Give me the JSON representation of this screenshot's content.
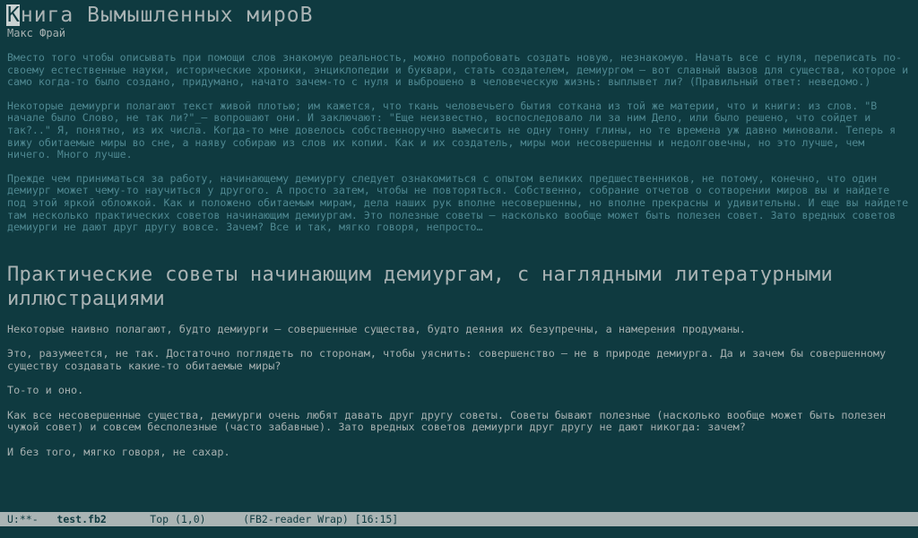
{
  "book": {
    "title_first": "К",
    "title_rest": "нига Вымышленных мироВ",
    "author": "Макс Фрай"
  },
  "annotation": [
    "Вместо того чтобы описывать при помощи слов знакомую реальность, можно попробовать создать новую, незнакомую. Начать все с нуля, переписать по-своему естественные науки, исторические хроники, энциклопедии и буквари, стать создателем, демиургом – вот славный вызов для существа, которое и само когда-то было создано, придумано, начато зачем-то с нуля и выброшено в человеческую жизнь: выплывет ли? (Правильный ответ: неведомо.)",
    "Некоторые демиурги полагают текст живой плотью; им кажется, что ткань человечьего бытия соткана из той же материи, что и книги: из слов. \"В начале было Слово, не так ли?\"_– вопрошают они. И заключают: \"Еще неизвестно, воспоследовало ли за ним Дело, или было решено, что сойдет и так?..\" Я, понятно, из их числа. Когда-то мне довелось собственноручно вымесить не одну тонну глины, но те времена уж давно миновали. Теперь я вижу обитаемые миры во сне, а наяву собираю из слов их копии. Как и их создатель, миры мои несовершенны и недолговечны, но это лучше, чем ничего. Много лучше.",
    "Прежде чем приниматься за работу, начинающему демиургу следует ознакомиться с опытом великих предшественников, не потому, конечно, что один демиург может чему-то научиться у другого. А просто затем, чтобы не повторяться. Собственно, собрание отчетов о сотворении миров вы и найдете под этой яркой обложкой. Как и положено обитаемым мирам, дела наших рук вполне несовершенны, но вполне прекрасны и удивительны. И еще вы найдете там несколько практических советов начинающим демиургам. Это полезные советы – насколько вообще может быть полезен совет. Зато вредных советов демиурги не дают друг другу вовсе. Зачем? Все и так, мягко говоря, непросто…"
  ],
  "section": {
    "title": "Практические советы начинающим демиургам, с наглядными литературными иллюстрациями",
    "paragraphs": [
      "Некоторые наивно полагают, будто демиурги – совершенные существа, будто деяния их безупречны, а намерения продуманы.",
      "Это, разумеется, не так. Достаточно поглядеть по сторонам, чтобы уяснить: совершенство – не в природе демиурга. Да и зачем бы совершенному существу создавать какие-то обитаемые миры?",
      "То-то и оно.",
      "Как все несовершенные существа, демиурги очень любят давать друг другу советы. Советы бывают полезные (насколько вообще может быть полезен чужой совет) и совсем бесполезные (часто забавные). Зато вредных советов демиурги друг другу не дают никогда: зачем?",
      "И без того, мягко говоря, не сахар."
    ]
  },
  "modeline": {
    "status": "U:**-",
    "buffer_name": "test.fb2",
    "position": "Top (1,0)",
    "modes": "(FB2-reader Wrap)",
    "time": "[16:15]"
  },
  "colors": {
    "background": "#0f3a40",
    "text": "#a6b0b0",
    "annotation_text": "#4f8891",
    "modeline_bg": "#aab4b4"
  }
}
